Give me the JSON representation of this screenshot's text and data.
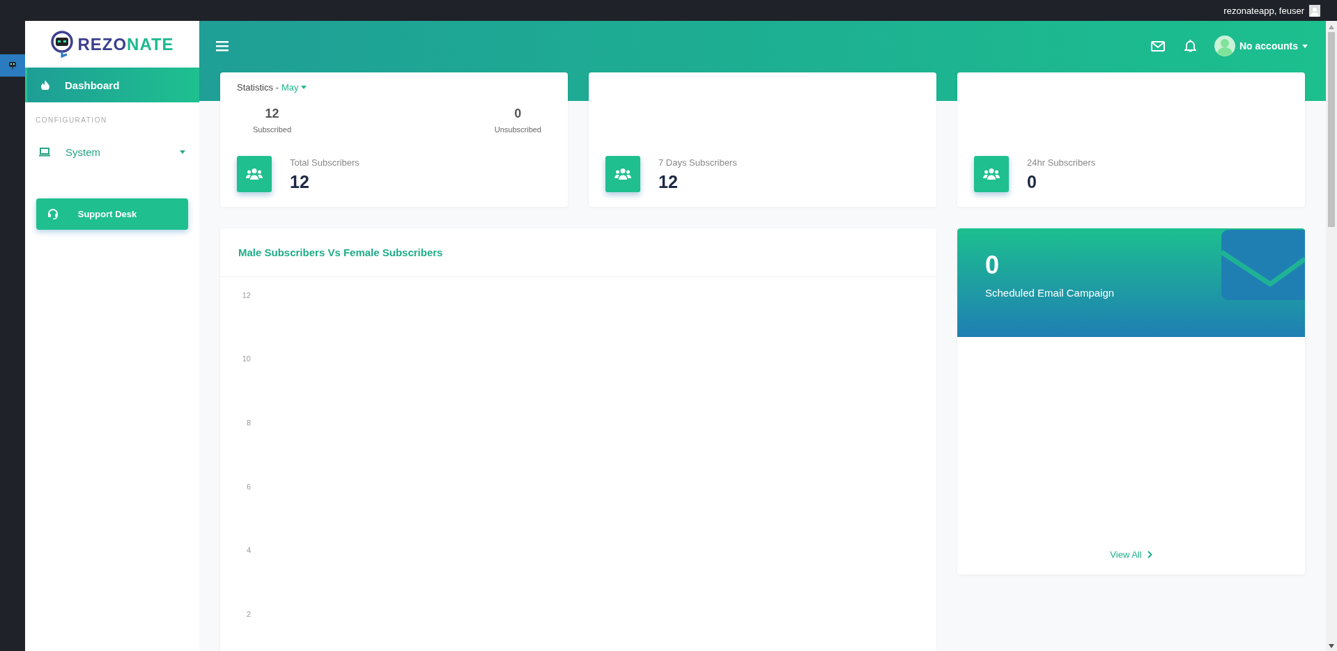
{
  "top_bar": {
    "user": "rezonateapp, feuser"
  },
  "logo": {
    "parts": [
      "REZO",
      "NATE"
    ]
  },
  "sidebar": {
    "menu": [
      {
        "label": "Dashboard",
        "selected": true
      }
    ],
    "configuration": {
      "heading": "CONFIGURATION",
      "items": [
        {
          "label": "System",
          "selected": false
        }
      ]
    },
    "support_button": "Support Desk"
  },
  "navbar": {
    "account": "No accounts"
  },
  "stat_cards": [
    {
      "statistics": {
        "title": "Statistics -",
        "month": "May",
        "counts": [
          {
            "value": "12",
            "label": "Subscribed"
          },
          {
            "value": "0",
            "label": "Unsubscribed"
          }
        ]
      },
      "label": "Total Subscribers",
      "value": "12"
    },
    {
      "label": "7 Days Subscribers",
      "value": "12"
    },
    {
      "label": "24hr Subscribers",
      "value": "0"
    }
  ],
  "chart_panel": {
    "title": "Male Subscribers Vs Female Subscribers",
    "axis_labels": [
      "12",
      "10",
      "8",
      "6",
      "4",
      "2"
    ]
  },
  "email_card": {
    "count": "0",
    "label": "Scheduled Email Campaign",
    "link": "View All"
  }
}
